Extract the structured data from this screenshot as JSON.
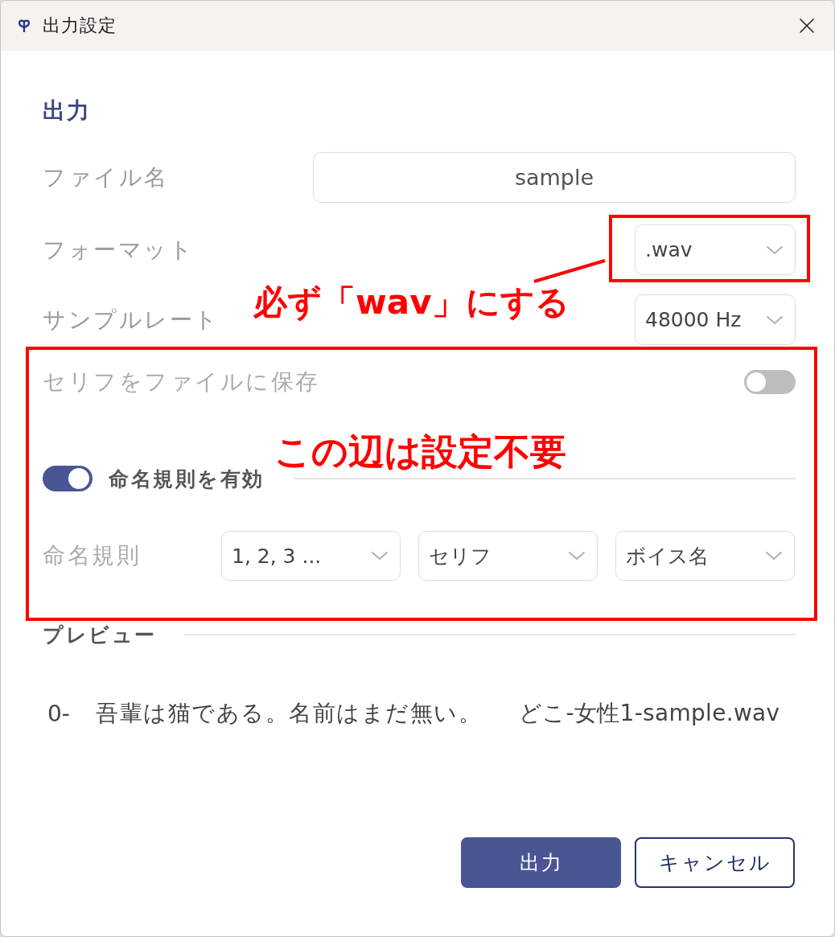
{
  "window": {
    "title": "出力設定"
  },
  "section": {
    "heading": "出力"
  },
  "fields": [
    {
      "kind": "text",
      "label": "ファイル名",
      "value": "sample"
    },
    {
      "kind": "select",
      "label": "フォーマット",
      "value": ".wav"
    },
    {
      "kind": "select",
      "label": "サンプルレート",
      "value": "48000 Hz"
    },
    {
      "kind": "toggle",
      "label": "セリフをファイルに保存",
      "on": false
    }
  ],
  "naming": {
    "label": "命名規則を有効",
    "on": true,
    "rule_label": "命名規則",
    "selects": [
      "1, 2, 3 ...",
      "セリフ",
      "ボイス名"
    ]
  },
  "preview": {
    "heading": "プレビュー",
    "index": "0-",
    "text": "吾輩は猫である。名前はまだ無い。",
    "filename": "どこ-女性1-sample.wav"
  },
  "buttons": [
    {
      "label": "出力",
      "kind": "primary"
    },
    {
      "label": "キャンセル",
      "kind": "secondary"
    }
  ],
  "annotations": [
    {
      "kind": "callout",
      "text": "必ず「wav」にする"
    },
    {
      "kind": "region",
      "text": "この辺は設定不要"
    }
  ]
}
